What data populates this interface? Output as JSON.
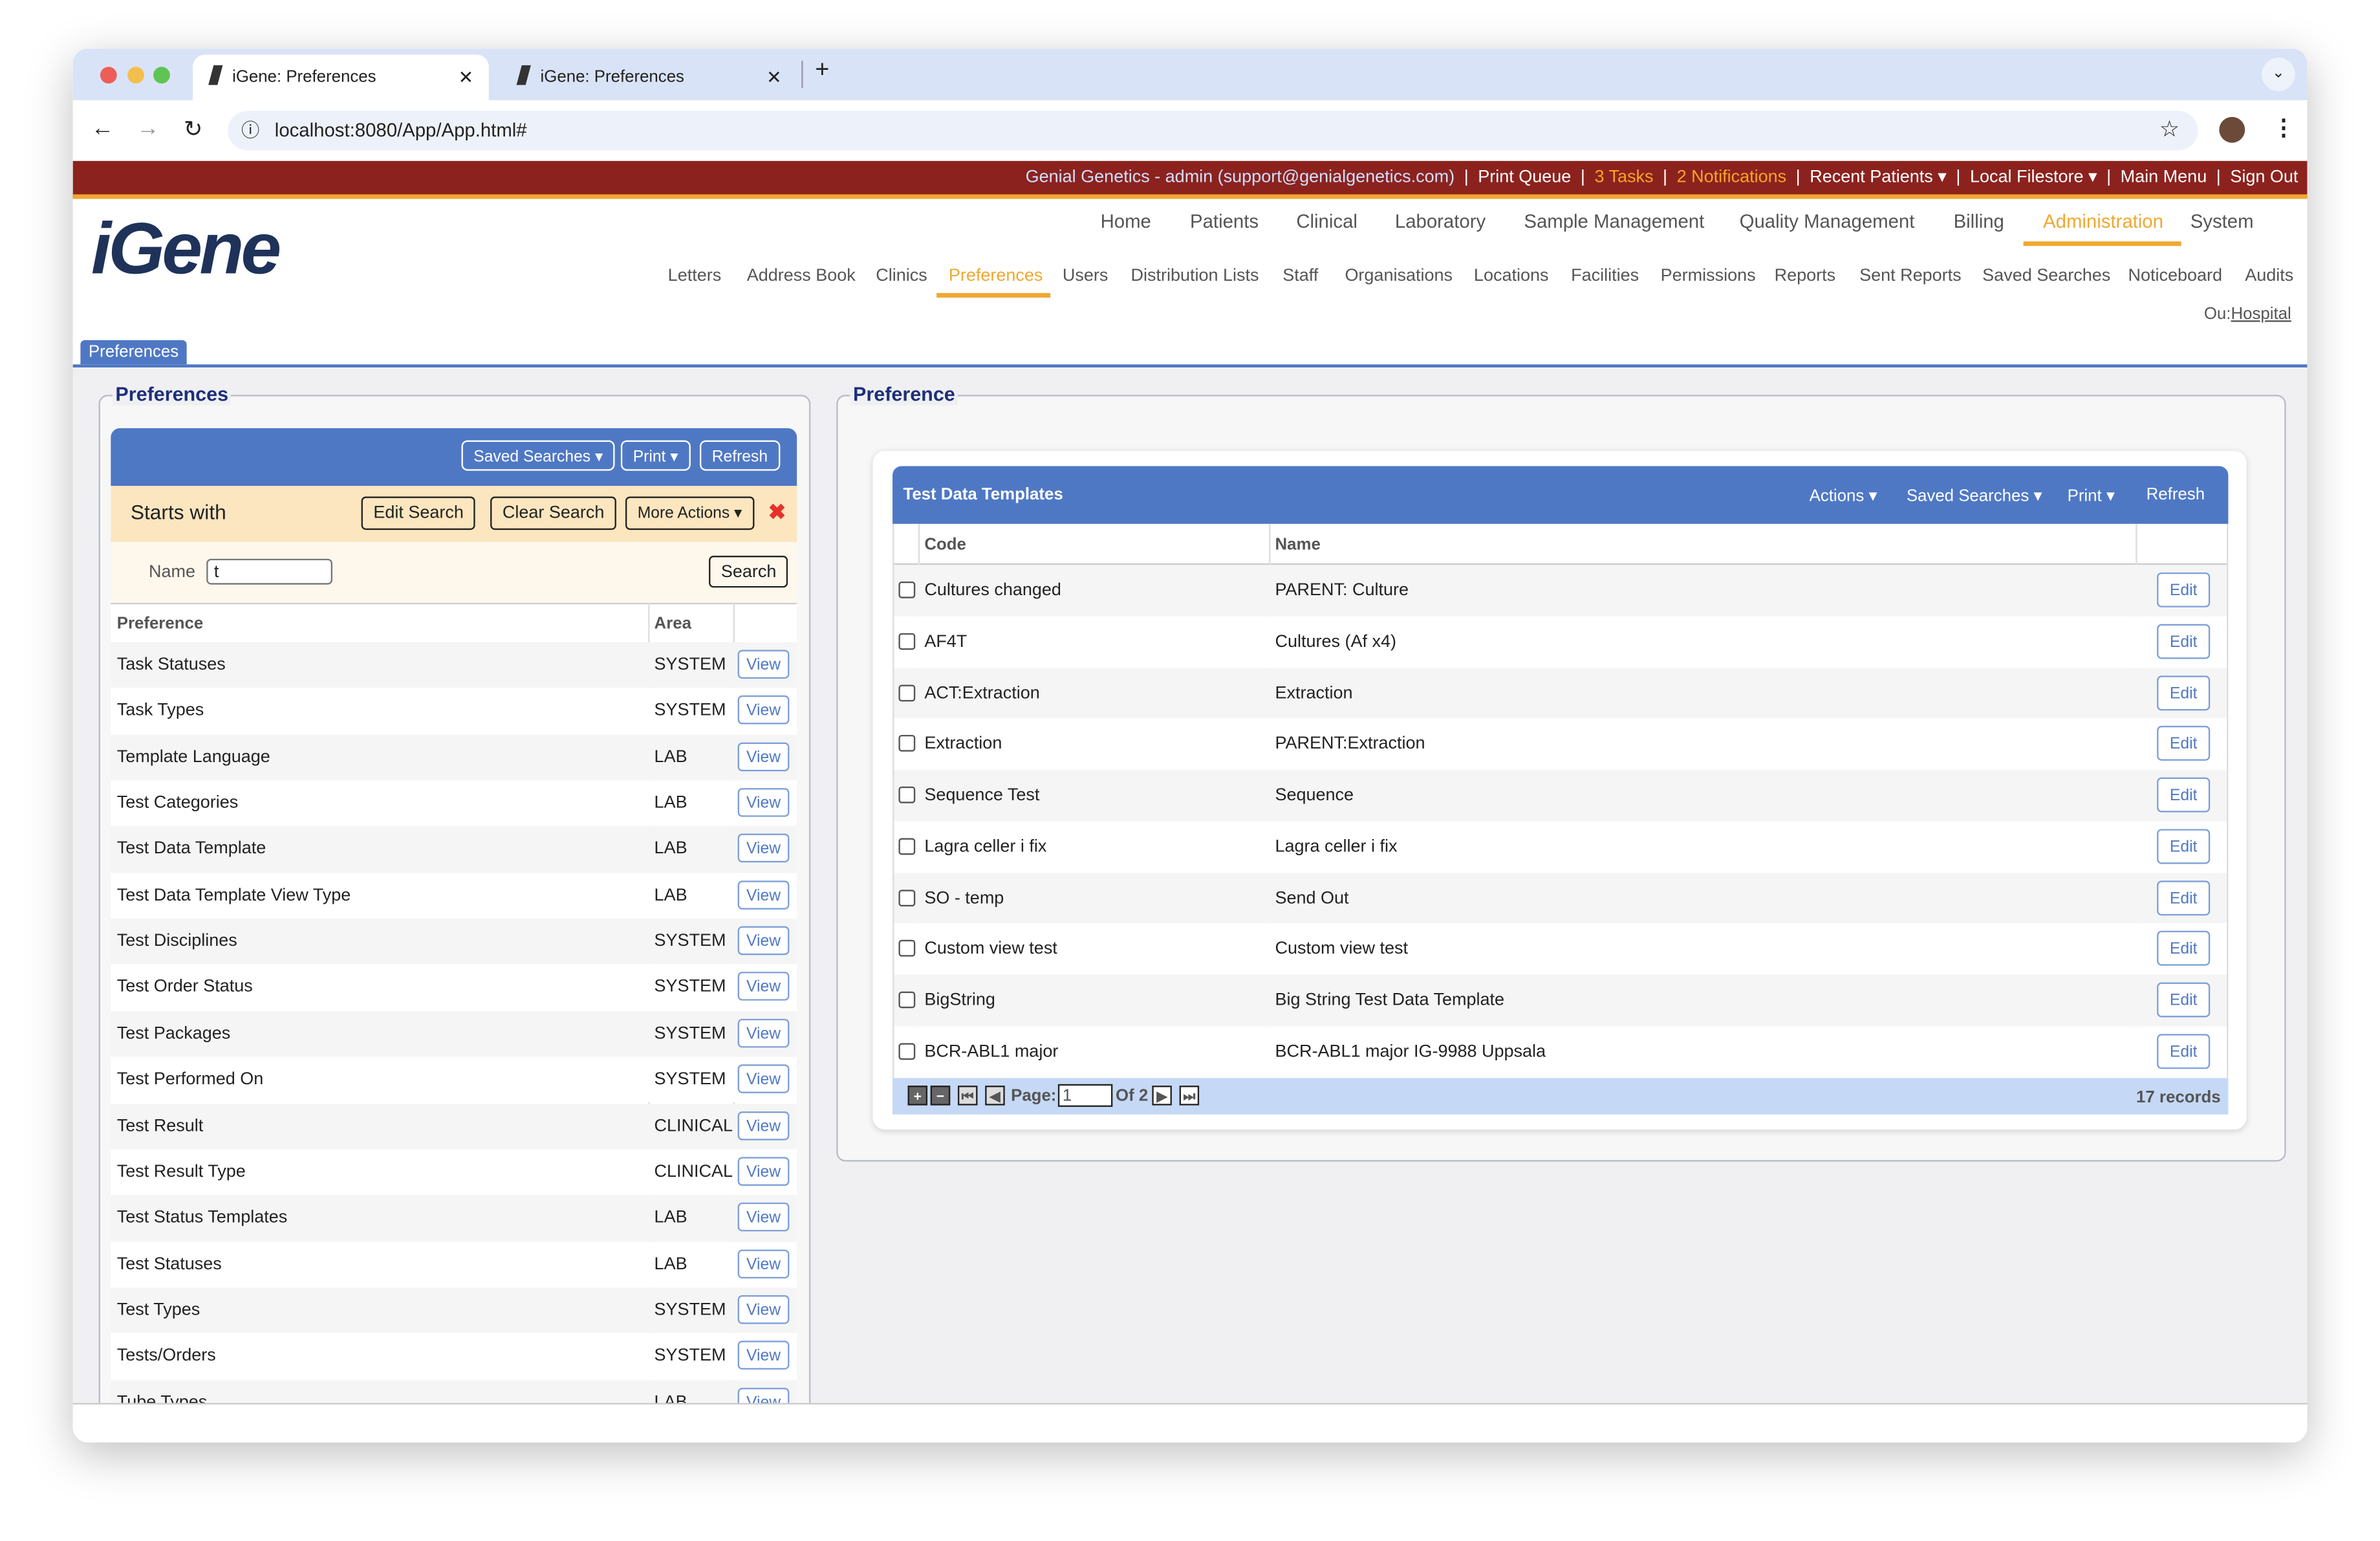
{
  "browser": {
    "tabs": [
      {
        "title": "iGene: Preferences",
        "active": true
      },
      {
        "title": "iGene: Preferences",
        "active": false
      }
    ],
    "url": "localhost:8080/App/App.html#"
  },
  "topbar": {
    "user": "Genial Genetics - admin (support@genialgenetics.com)",
    "items": [
      "Print Queue",
      "3 Tasks",
      "2 Notifications",
      "Recent Patients ▾",
      "Local Filestore ▾",
      "Main Menu",
      "Sign Out"
    ]
  },
  "logo": "iGene",
  "main_nav": [
    "Home",
    "Patients",
    "Clinical",
    "Laboratory",
    "Sample Management",
    "Quality Management",
    "Billing",
    "Administration",
    "System"
  ],
  "sub_nav": [
    "Letters",
    "Address Book",
    "Clinics",
    "Preferences",
    "Users",
    "Distribution Lists",
    "Staff",
    "Organisations",
    "Locations",
    "Facilities",
    "Permissions",
    "Reports",
    "Sent Reports",
    "Saved Searches",
    "Noticeboard",
    "Audits"
  ],
  "ou": {
    "label": "Ou:",
    "value": "Hospital"
  },
  "page_tab": "Preferences",
  "left": {
    "legend": "Preferences",
    "toolbar": {
      "saved_searches": "Saved Searches ▾",
      "print": "Print ▾",
      "refresh": "Refresh"
    },
    "search": {
      "title": "Starts with",
      "edit": "Edit Search",
      "clear": "Clear Search",
      "more": "More Actions ▾",
      "close": "✖",
      "name_label": "Name",
      "name_value": "t",
      "search": "Search"
    },
    "columns": [
      "Preference",
      "Area"
    ],
    "view_label": "View",
    "rows": [
      [
        "Task Statuses",
        "SYSTEM"
      ],
      [
        "Task Types",
        "SYSTEM"
      ],
      [
        "Template Language",
        "LAB"
      ],
      [
        "Test Categories",
        "LAB"
      ],
      [
        "Test Data Template",
        "LAB"
      ],
      [
        "Test Data Template View Type",
        "LAB"
      ],
      [
        "Test Disciplines",
        "SYSTEM"
      ],
      [
        "Test Order Status",
        "SYSTEM"
      ],
      [
        "Test Packages",
        "SYSTEM"
      ],
      [
        "Test Performed On",
        "SYSTEM"
      ],
      [
        "Test Result",
        "CLINICAL"
      ],
      [
        "Test Result Type",
        "CLINICAL"
      ],
      [
        "Test Status Templates",
        "LAB"
      ],
      [
        "Test Statuses",
        "LAB"
      ],
      [
        "Test Types",
        "SYSTEM"
      ],
      [
        "Tests/Orders",
        "SYSTEM"
      ],
      [
        "Tube Types",
        "LAB"
      ]
    ]
  },
  "right": {
    "legend": "Preference",
    "title": "Test Data Templates",
    "toolbar": {
      "actions": "Actions ▾",
      "saved_searches": "Saved Searches ▾",
      "print": "Print ▾",
      "refresh": "Refresh"
    },
    "columns": [
      "Code",
      "Name"
    ],
    "edit_label": "Edit",
    "rows": [
      [
        "Cultures changed",
        "PARENT: Culture"
      ],
      [
        "AF4T",
        "Cultures (Af x4)"
      ],
      [
        "ACT:Extraction",
        "Extraction"
      ],
      [
        "Extraction",
        "PARENT:Extraction"
      ],
      [
        "Sequence Test",
        "Sequence"
      ],
      [
        "Lagra celler i fix",
        "Lagra celler i fix"
      ],
      [
        "SO - temp",
        "Send Out"
      ],
      [
        "Custom view test",
        "Custom view test"
      ],
      [
        "BigString",
        "Big String Test Data Template"
      ],
      [
        "BCR-ABL1 major",
        "BCR-ABL1 major IG-9988 Uppsala"
      ]
    ],
    "pager": {
      "page_label": "Page:",
      "page": "1",
      "of": "Of 2",
      "records": "17 records"
    }
  },
  "colors": {
    "brand_red": "#8c221e",
    "accent_orange": "#f0a830",
    "panel_blue": "#4f78c4"
  }
}
